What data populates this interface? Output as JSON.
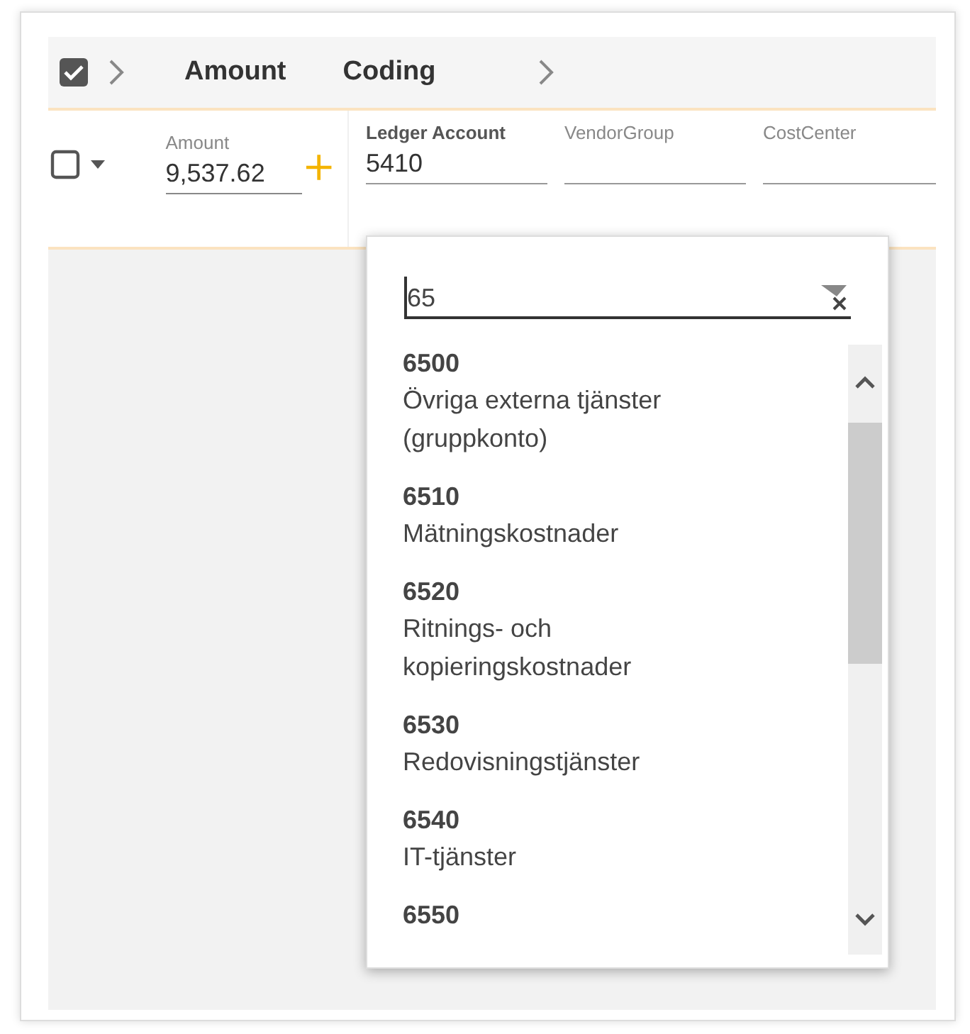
{
  "header": {
    "checked": true,
    "columns": [
      "Amount",
      "Coding"
    ]
  },
  "row": {
    "checked": false,
    "fields": [
      {
        "label": "Amount",
        "value": "9,537.62"
      },
      {
        "label": "Ledger Account",
        "value": "5410"
      },
      {
        "label": "VendorGroup"
      },
      {
        "label": "CostCenter"
      }
    ]
  },
  "dropdown": {
    "search": "65",
    "items": [
      {
        "code": "6500",
        "description": "Övriga externa tjänster (gruppkonto)"
      },
      {
        "code": "6510",
        "description": "Mätningskostnader"
      },
      {
        "code": "6520",
        "description": "Ritnings- och kopieringskostnader"
      },
      {
        "code": "6530",
        "description": "Redovisningstjänster"
      },
      {
        "code": "6540",
        "description": "IT-tjänster"
      },
      {
        "code": "6550"
      }
    ]
  }
}
